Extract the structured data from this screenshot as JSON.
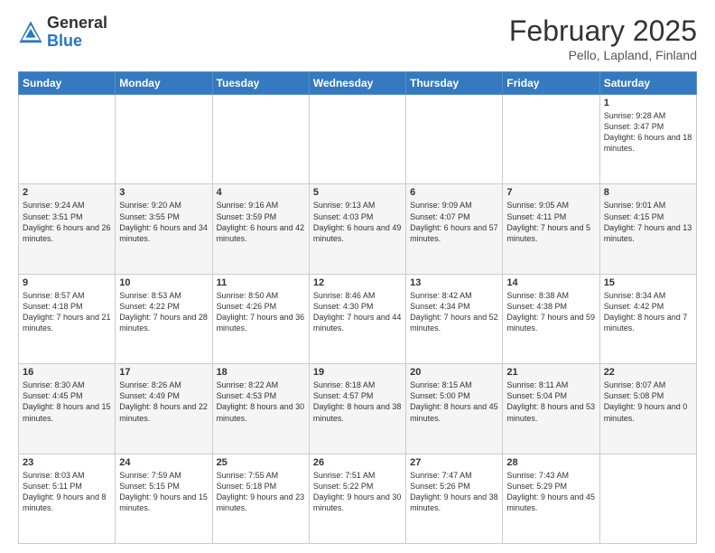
{
  "header": {
    "logo_general": "General",
    "logo_blue": "Blue",
    "month_title": "February 2025",
    "location": "Pello, Lapland, Finland"
  },
  "days_of_week": [
    "Sunday",
    "Monday",
    "Tuesday",
    "Wednesday",
    "Thursday",
    "Friday",
    "Saturday"
  ],
  "weeks": [
    [
      {
        "day": "",
        "info": ""
      },
      {
        "day": "",
        "info": ""
      },
      {
        "day": "",
        "info": ""
      },
      {
        "day": "",
        "info": ""
      },
      {
        "day": "",
        "info": ""
      },
      {
        "day": "",
        "info": ""
      },
      {
        "day": "1",
        "info": "Sunrise: 9:28 AM\nSunset: 3:47 PM\nDaylight: 6 hours and 18 minutes."
      }
    ],
    [
      {
        "day": "2",
        "info": "Sunrise: 9:24 AM\nSunset: 3:51 PM\nDaylight: 6 hours and 26 minutes."
      },
      {
        "day": "3",
        "info": "Sunrise: 9:20 AM\nSunset: 3:55 PM\nDaylight: 6 hours and 34 minutes."
      },
      {
        "day": "4",
        "info": "Sunrise: 9:16 AM\nSunset: 3:59 PM\nDaylight: 6 hours and 42 minutes."
      },
      {
        "day": "5",
        "info": "Sunrise: 9:13 AM\nSunset: 4:03 PM\nDaylight: 6 hours and 49 minutes."
      },
      {
        "day": "6",
        "info": "Sunrise: 9:09 AM\nSunset: 4:07 PM\nDaylight: 6 hours and 57 minutes."
      },
      {
        "day": "7",
        "info": "Sunrise: 9:05 AM\nSunset: 4:11 PM\nDaylight: 7 hours and 5 minutes."
      },
      {
        "day": "8",
        "info": "Sunrise: 9:01 AM\nSunset: 4:15 PM\nDaylight: 7 hours and 13 minutes."
      }
    ],
    [
      {
        "day": "9",
        "info": "Sunrise: 8:57 AM\nSunset: 4:18 PM\nDaylight: 7 hours and 21 minutes."
      },
      {
        "day": "10",
        "info": "Sunrise: 8:53 AM\nSunset: 4:22 PM\nDaylight: 7 hours and 28 minutes."
      },
      {
        "day": "11",
        "info": "Sunrise: 8:50 AM\nSunset: 4:26 PM\nDaylight: 7 hours and 36 minutes."
      },
      {
        "day": "12",
        "info": "Sunrise: 8:46 AM\nSunset: 4:30 PM\nDaylight: 7 hours and 44 minutes."
      },
      {
        "day": "13",
        "info": "Sunrise: 8:42 AM\nSunset: 4:34 PM\nDaylight: 7 hours and 52 minutes."
      },
      {
        "day": "14",
        "info": "Sunrise: 8:38 AM\nSunset: 4:38 PM\nDaylight: 7 hours and 59 minutes."
      },
      {
        "day": "15",
        "info": "Sunrise: 8:34 AM\nSunset: 4:42 PM\nDaylight: 8 hours and 7 minutes."
      }
    ],
    [
      {
        "day": "16",
        "info": "Sunrise: 8:30 AM\nSunset: 4:45 PM\nDaylight: 8 hours and 15 minutes."
      },
      {
        "day": "17",
        "info": "Sunrise: 8:26 AM\nSunset: 4:49 PM\nDaylight: 8 hours and 22 minutes."
      },
      {
        "day": "18",
        "info": "Sunrise: 8:22 AM\nSunset: 4:53 PM\nDaylight: 8 hours and 30 minutes."
      },
      {
        "day": "19",
        "info": "Sunrise: 8:18 AM\nSunset: 4:57 PM\nDaylight: 8 hours and 38 minutes."
      },
      {
        "day": "20",
        "info": "Sunrise: 8:15 AM\nSunset: 5:00 PM\nDaylight: 8 hours and 45 minutes."
      },
      {
        "day": "21",
        "info": "Sunrise: 8:11 AM\nSunset: 5:04 PM\nDaylight: 8 hours and 53 minutes."
      },
      {
        "day": "22",
        "info": "Sunrise: 8:07 AM\nSunset: 5:08 PM\nDaylight: 9 hours and 0 minutes."
      }
    ],
    [
      {
        "day": "23",
        "info": "Sunrise: 8:03 AM\nSunset: 5:11 PM\nDaylight: 9 hours and 8 minutes."
      },
      {
        "day": "24",
        "info": "Sunrise: 7:59 AM\nSunset: 5:15 PM\nDaylight: 9 hours and 15 minutes."
      },
      {
        "day": "25",
        "info": "Sunrise: 7:55 AM\nSunset: 5:18 PM\nDaylight: 9 hours and 23 minutes."
      },
      {
        "day": "26",
        "info": "Sunrise: 7:51 AM\nSunset: 5:22 PM\nDaylight: 9 hours and 30 minutes."
      },
      {
        "day": "27",
        "info": "Sunrise: 7:47 AM\nSunset: 5:26 PM\nDaylight: 9 hours and 38 minutes."
      },
      {
        "day": "28",
        "info": "Sunrise: 7:43 AM\nSunset: 5:29 PM\nDaylight: 9 hours and 45 minutes."
      },
      {
        "day": "",
        "info": ""
      }
    ]
  ]
}
